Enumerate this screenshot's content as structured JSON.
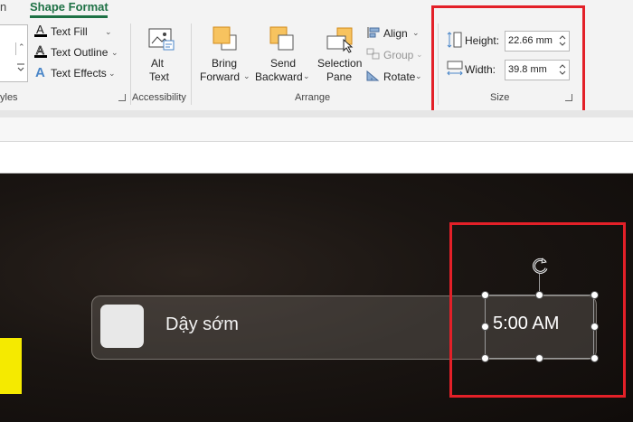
{
  "tabs": {
    "left_fragment": "n",
    "active": "Shape Format"
  },
  "ribbon": {
    "styles_group_label": "yles",
    "text_fill": "Text Fill",
    "text_outline": "Text Outline",
    "text_effects": "Text Effects",
    "alt_text_line1": "Alt",
    "alt_text_line2": "Text",
    "accessibility_label": "Accessibility",
    "bring_forward_line1": "Bring",
    "bring_forward_line2": "Forward",
    "send_backward_line1": "Send",
    "send_backward_line2": "Backward",
    "selection_pane_line1": "Selection",
    "selection_pane_line2": "Pane",
    "align": "Align",
    "group": "Group",
    "rotate": "Rotate",
    "arrange_label": "Arrange",
    "height_label": "Height:",
    "height_value": "22.66 mm",
    "width_label": "Width:",
    "width_value": "39.8 mm",
    "size_label": "Size"
  },
  "slide": {
    "task_text": "Dậy sớm",
    "time_text": "5:00 AM"
  },
  "colors": {
    "accent_green": "#1e7145",
    "highlight_red": "#e32028",
    "yellow": "#f5ea00"
  }
}
